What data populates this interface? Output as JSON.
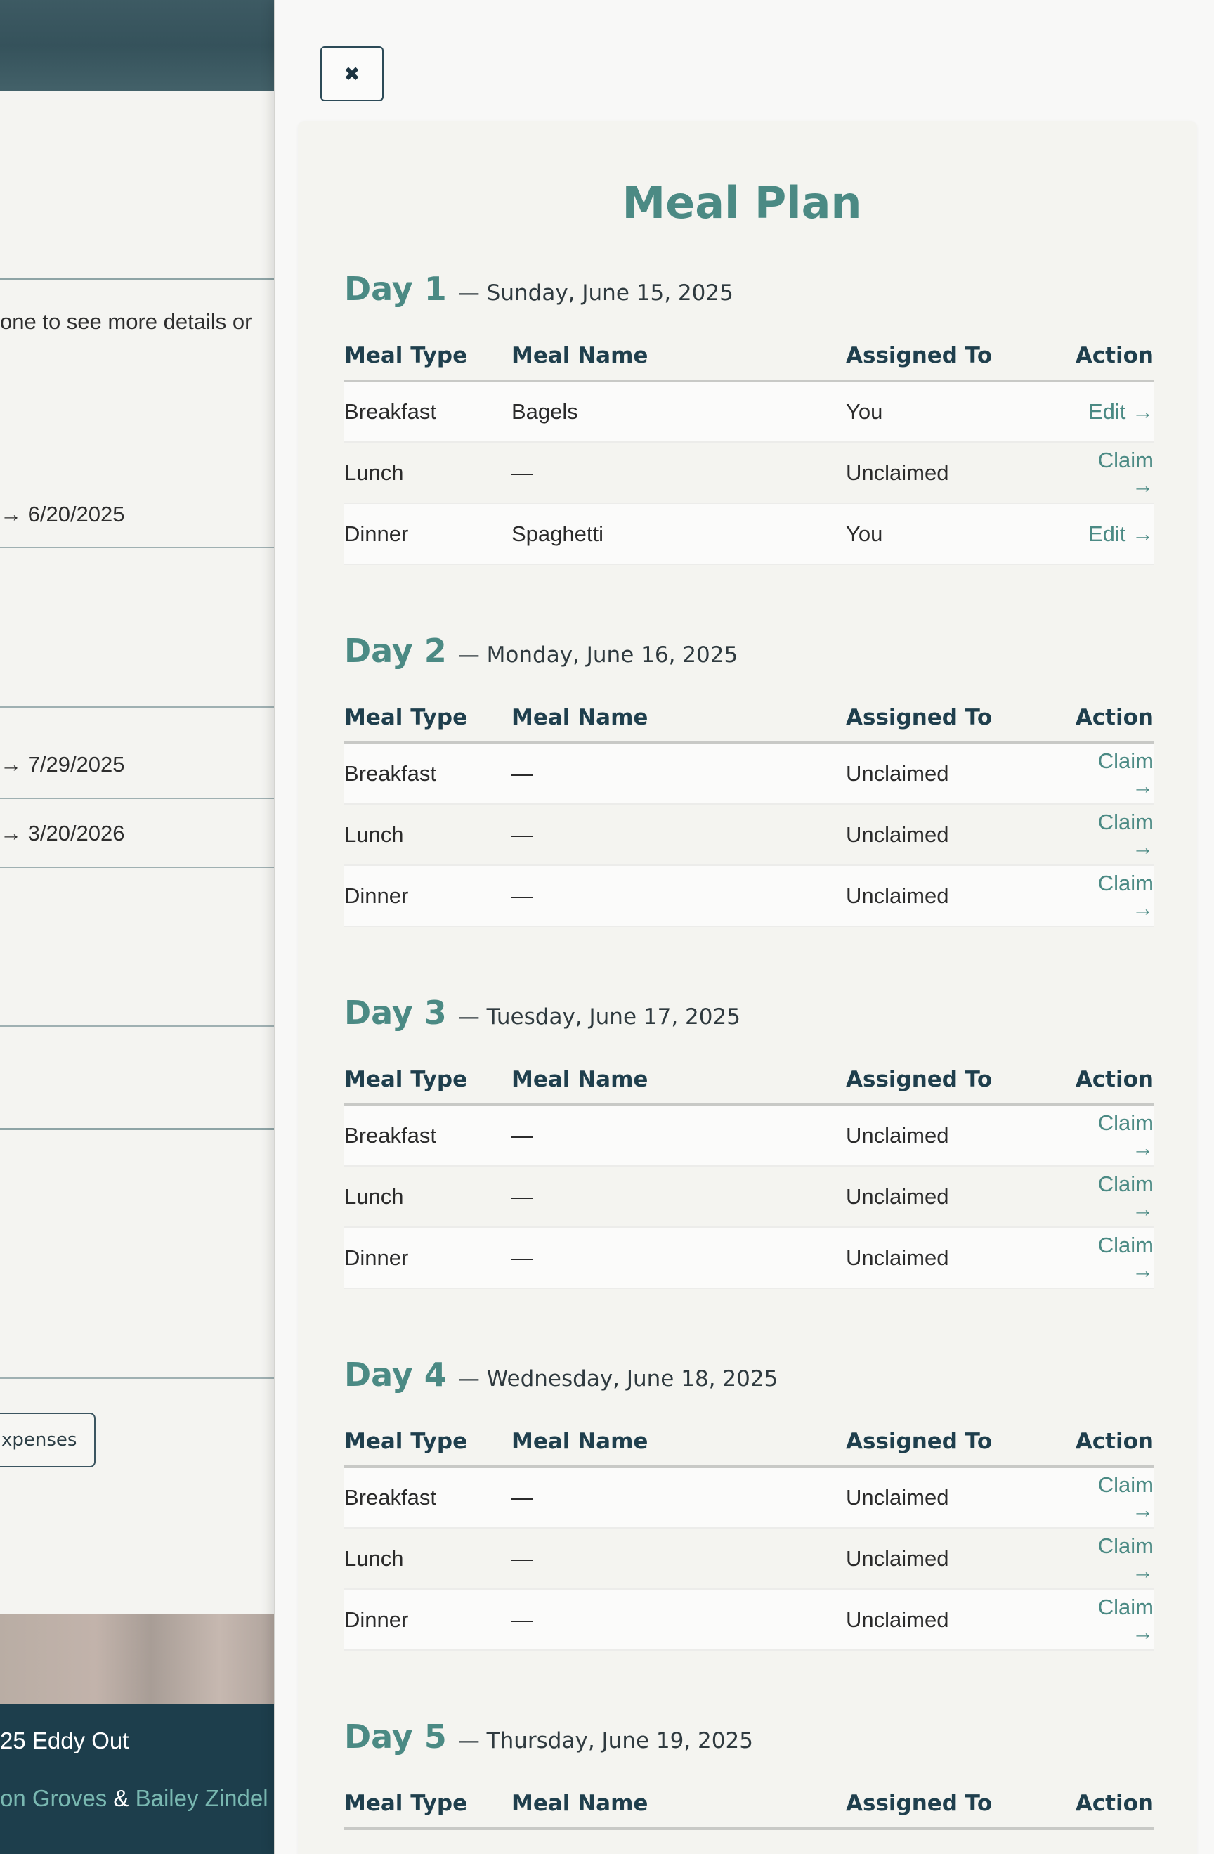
{
  "background": {
    "fragments": {
      "instructions_tail": "one to see more details or",
      "date_range_1": "→ 6/20/2025",
      "date_range_2": "→ 7/29/2025",
      "date_range_3": "→ 3/20/2026"
    },
    "expenses_button": "xpenses",
    "footer": {
      "line1": "25 Eddy Out",
      "author1": "on Groves",
      "amp": " & ",
      "author2": "Bailey Zindel"
    }
  },
  "drawer": {
    "close_label": "✖",
    "title": "Meal Plan",
    "columns": {
      "meal_type": "Meal Type",
      "meal_name": "Meal Name",
      "assigned_to": "Assigned To",
      "action": "Action"
    },
    "days": [
      {
        "label": "Day 1",
        "date": "— Sunday, June 15, 2025",
        "meals": [
          {
            "type": "Breakfast",
            "name": "Bagels",
            "assigned": "You",
            "action": "Edit →"
          },
          {
            "type": "Lunch",
            "name": "—",
            "assigned": "Unclaimed",
            "action": "Claim →"
          },
          {
            "type": "Dinner",
            "name": "Spaghetti",
            "assigned": "You",
            "action": "Edit →"
          }
        ]
      },
      {
        "label": "Day 2",
        "date": "— Monday, June 16, 2025",
        "meals": [
          {
            "type": "Breakfast",
            "name": "—",
            "assigned": "Unclaimed",
            "action": "Claim →"
          },
          {
            "type": "Lunch",
            "name": "—",
            "assigned": "Unclaimed",
            "action": "Claim →"
          },
          {
            "type": "Dinner",
            "name": "—",
            "assigned": "Unclaimed",
            "action": "Claim →"
          }
        ]
      },
      {
        "label": "Day 3",
        "date": "— Tuesday, June 17, 2025",
        "meals": [
          {
            "type": "Breakfast",
            "name": "—",
            "assigned": "Unclaimed",
            "action": "Claim →"
          },
          {
            "type": "Lunch",
            "name": "—",
            "assigned": "Unclaimed",
            "action": "Claim →"
          },
          {
            "type": "Dinner",
            "name": "—",
            "assigned": "Unclaimed",
            "action": "Claim →"
          }
        ]
      },
      {
        "label": "Day 4",
        "date": "— Wednesday, June 18, 2025",
        "meals": [
          {
            "type": "Breakfast",
            "name": "—",
            "assigned": "Unclaimed",
            "action": "Claim →"
          },
          {
            "type": "Lunch",
            "name": "—",
            "assigned": "Unclaimed",
            "action": "Claim →"
          },
          {
            "type": "Dinner",
            "name": "—",
            "assigned": "Unclaimed",
            "action": "Claim →"
          }
        ]
      },
      {
        "label": "Day 5",
        "date": "— Thursday, June 19, 2025",
        "meals": []
      }
    ]
  }
}
